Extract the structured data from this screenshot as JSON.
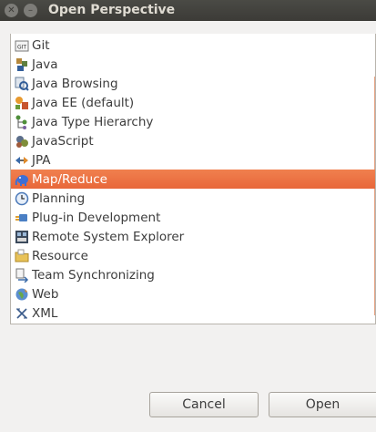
{
  "window": {
    "title": "Open Perspective",
    "close_glyph": "✕",
    "minimize_glyph": "–"
  },
  "perspectives": [
    {
      "label": "Git",
      "icon": "git-icon",
      "selected": false
    },
    {
      "label": "Java",
      "icon": "java-icon",
      "selected": false
    },
    {
      "label": "Java Browsing",
      "icon": "java-browsing-icon",
      "selected": false
    },
    {
      "label": "Java EE (default)",
      "icon": "java-ee-icon",
      "selected": false
    },
    {
      "label": "Java Type Hierarchy",
      "icon": "type-hierarchy-icon",
      "selected": false
    },
    {
      "label": "JavaScript",
      "icon": "javascript-icon",
      "selected": false
    },
    {
      "label": "JPA",
      "icon": "jpa-icon",
      "selected": false
    },
    {
      "label": "Map/Reduce",
      "icon": "elephant-icon",
      "selected": true
    },
    {
      "label": "Planning",
      "icon": "clock-icon",
      "selected": false
    },
    {
      "label": "Plug-in Development",
      "icon": "plugin-icon",
      "selected": false
    },
    {
      "label": "Remote System Explorer",
      "icon": "remote-system-icon",
      "selected": false
    },
    {
      "label": "Resource",
      "icon": "folder-icon",
      "selected": false
    },
    {
      "label": "Team Synchronizing",
      "icon": "sync-icon",
      "selected": false
    },
    {
      "label": "Web",
      "icon": "web-globe-icon",
      "selected": false
    },
    {
      "label": "XML",
      "icon": "xml-icon",
      "selected": false
    }
  ],
  "buttons": {
    "cancel": "Cancel",
    "open": "Open"
  },
  "colors": {
    "selection": "#e8673a",
    "titlebar": "#3c3b37"
  }
}
